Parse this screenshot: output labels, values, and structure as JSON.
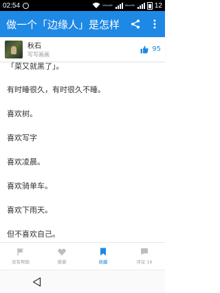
{
  "status_bar": {
    "time": "02:54",
    "signal_labels": [
      "Micro56",
      "Micro56"
    ],
    "battery": "12"
  },
  "app_bar": {
    "title": "做一个「边缘人」是怎样 .."
  },
  "author": {
    "name": "秋石",
    "tagline": "写写画画",
    "votes": "95"
  },
  "content": {
    "paragraphs": [
      "「菜又就黑了」。",
      "有时睡很久，有时很久不睡。",
      "喜欢树。",
      "喜欢写字",
      "喜欢凌晨。",
      "喜欢骑单车。",
      "喜欢下雨天。",
      "但不喜欢自己。"
    ]
  },
  "bottom_bar": {
    "items": [
      {
        "label": "没有帮助",
        "icon": "flag-icon"
      },
      {
        "label": "感谢",
        "icon": "heart-icon"
      },
      {
        "label": "收藏",
        "icon": "bookmark-icon"
      },
      {
        "label": "评论 16",
        "icon": "comment-icon"
      }
    ],
    "active": "收藏"
  },
  "colors": {
    "accent": "#1e88e5",
    "inactive": "#bdbdbd"
  }
}
